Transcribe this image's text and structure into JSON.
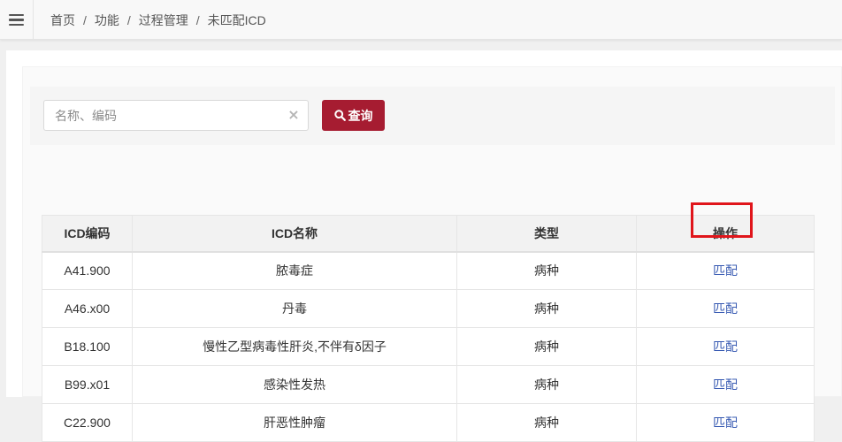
{
  "breadcrumb": [
    "首页",
    "功能",
    "过程管理",
    "未匹配ICD"
  ],
  "breadcrumb_separator": "/",
  "search": {
    "placeholder": "名称、编码",
    "value": "",
    "button_label": "查询"
  },
  "table": {
    "headers": [
      "ICD编码",
      "ICD名称",
      "类型",
      "操作"
    ],
    "rows": [
      {
        "code": "A41.900",
        "name": "脓毒症",
        "type": "病种",
        "action": "匹配"
      },
      {
        "code": "A46.x00",
        "name": "丹毒",
        "type": "病种",
        "action": "匹配"
      },
      {
        "code": "B18.100",
        "name": "慢性乙型病毒性肝炎,不伴有δ因子",
        "type": "病种",
        "action": "匹配"
      },
      {
        "code": "B99.x01",
        "name": "感染性发热",
        "type": "病种",
        "action": "匹配"
      },
      {
        "code": "C22.900",
        "name": "肝恶性肿瘤",
        "type": "病种",
        "action": "匹配"
      }
    ]
  },
  "colors": {
    "primary_button": "#a61c31",
    "link": "#3a5cb3",
    "highlight": "#e0151b"
  },
  "icons": {
    "menu": "hamburger-icon",
    "clear": "clear-icon",
    "search": "search-icon"
  }
}
